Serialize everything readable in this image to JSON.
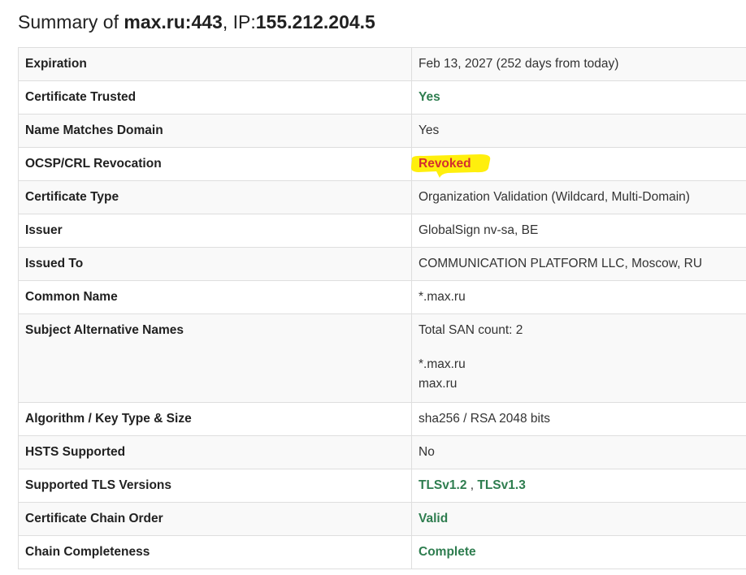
{
  "header": {
    "prefix": "Summary of ",
    "host": "max.ru:443",
    "ip_label": ", IP:",
    "ip": "155.212.204.5"
  },
  "rows": [
    {
      "label": "Expiration",
      "value": "Feb 13, 2027 (252 days from today)"
    },
    {
      "label": "Certificate Trusted",
      "value": "Yes"
    },
    {
      "label": "Name Matches Domain",
      "value": "Yes"
    },
    {
      "label": "OCSP/CRL Revocation",
      "value": "Revoked"
    },
    {
      "label": "Certificate Type",
      "value": "Organization Validation (Wildcard, Multi-Domain)"
    },
    {
      "label": "Issuer",
      "value": "GlobalSign nv-sa, BE"
    },
    {
      "label": "Issued To",
      "value": "COMMUNICATION PLATFORM LLC, Moscow, RU"
    },
    {
      "label": "Common Name",
      "value": "*.max.ru"
    },
    {
      "label": "Subject Alternative Names",
      "count_text": "Total SAN count: 2",
      "names": [
        "*.max.ru",
        "max.ru"
      ]
    },
    {
      "label": "Algorithm / Key Type & Size",
      "value": "sha256 / RSA 2048 bits"
    },
    {
      "label": "HSTS Supported",
      "value": "No"
    },
    {
      "label": "Supported TLS Versions",
      "versions": [
        "TLSv1.2",
        "TLSv1.3"
      ],
      "separator": " , "
    },
    {
      "label": "Certificate Chain Order",
      "value": "Valid"
    },
    {
      "label": "Chain Completeness",
      "value": "Complete"
    }
  ],
  "colors": {
    "good": "#2e7d4f",
    "bad": "#d32f2f",
    "highlight": "#ffee00"
  }
}
